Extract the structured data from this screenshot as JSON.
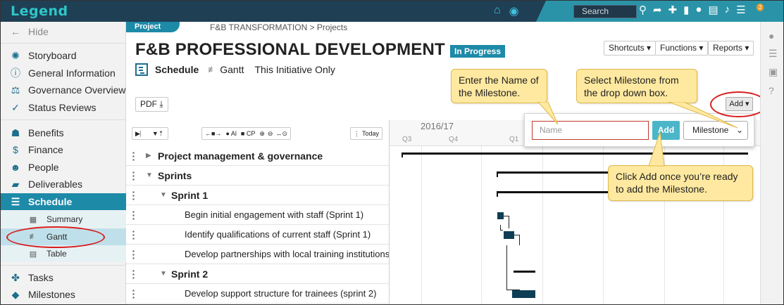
{
  "app": {
    "brand": "Legend"
  },
  "topbar": {
    "search_placeholder": "Search",
    "notification_count": "2"
  },
  "sidebar": {
    "hide": "Hide",
    "items": [
      {
        "label": "Storyboard",
        "icon": "storyboard-icon"
      },
      {
        "label": "General Information",
        "icon": "info-icon"
      },
      {
        "label": "Governance Overview",
        "icon": "governance-icon"
      },
      {
        "label": "Status Reviews",
        "icon": "status-reviews-icon"
      },
      {
        "label": "Benefits",
        "icon": "benefits-icon"
      },
      {
        "label": "Finance",
        "icon": "dollar-icon"
      },
      {
        "label": "People",
        "icon": "people-icon"
      },
      {
        "label": "Deliverables",
        "icon": "truck-icon"
      },
      {
        "label": "Schedule",
        "icon": "schedule-icon"
      },
      {
        "label": "Tasks",
        "icon": "tasks-icon"
      },
      {
        "label": "Milestones",
        "icon": "diamond-icon"
      }
    ],
    "schedule_sub": [
      {
        "label": "Summary",
        "icon": "summary-icon"
      },
      {
        "label": "Gantt",
        "icon": "gantt-icon"
      },
      {
        "label": "Table",
        "icon": "table-icon"
      }
    ]
  },
  "header": {
    "tab": "Project",
    "breadcrumb": "F&B TRANSFORMATION > Projects",
    "title": "F&B PROFESSIONAL DEVELOPMENT",
    "status": "In Progress",
    "buttons": [
      "Shortcuts ▾",
      "Functions ▾",
      "Reports ▾"
    ],
    "schedule_label": "Schedule",
    "gantt_label": "Gantt",
    "scope_label": "This Initiative Only",
    "pdf_label": "PDF"
  },
  "gantt_toolbar": {
    "all_label": "Al",
    "cp_label": "CP",
    "today_label": "Today"
  },
  "gantt_rows": [
    {
      "label": "Project management & governance",
      "level": 0,
      "expanded": false
    },
    {
      "label": "Sprints",
      "level": 0,
      "expanded": true
    },
    {
      "label": "Sprint 1",
      "level": 1,
      "expanded": true
    },
    {
      "label": "Begin initial engagement with staff (Sprint 1)",
      "level": 2
    },
    {
      "label": "Identify qualifications of current staff (Sprint 1)",
      "level": 2
    },
    {
      "label": "Develop partnerships with local training institutions",
      "level": 2
    },
    {
      "label": "Sprint 2",
      "level": 1,
      "expanded": true
    },
    {
      "label": "Develop support structure for trainees (sprint 2)",
      "level": 2
    }
  ],
  "timeline": {
    "year": "2016/17",
    "quarters": [
      "Q3",
      "Q4",
      "Q1"
    ]
  },
  "milestone_popup": {
    "name_placeholder": "Name",
    "add_label": "Add",
    "type_value": "Milestone"
  },
  "add_dropdown": "Add ▾",
  "callouts": {
    "name": "Enter the Name of the Milestone.",
    "select": "Select Milestone from the drop down box.",
    "add": "Click Add once you’re ready to add the Milestone."
  },
  "colors": {
    "brand": "#2ec7c9",
    "accent": "#1d8aa8",
    "topbar": "#1f3f54",
    "callout": "#ffe9a0",
    "highlight": "#d81e1e"
  }
}
